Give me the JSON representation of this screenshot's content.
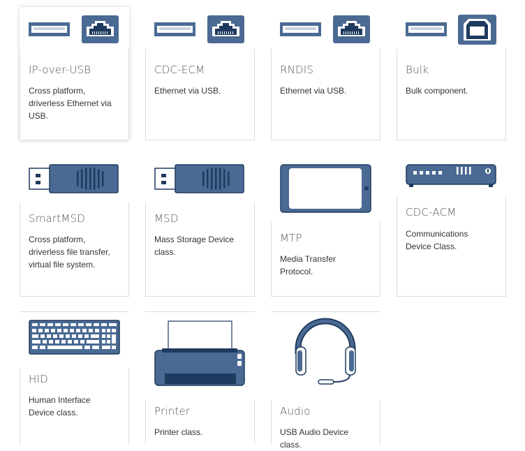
{
  "colors": {
    "icon_fill": "#4a6a93",
    "icon_dark": "#1f3a5f",
    "border": "#dcdcdc"
  },
  "cards": [
    {
      "title": "IP-over-USB",
      "description": "Cross platform, driverless Ethernet via USB.",
      "icon": "usb-ethernet-icon"
    },
    {
      "title": "CDC-ECM",
      "description": "Ethernet via USB.",
      "icon": "usb-ethernet-icon"
    },
    {
      "title": "RNDIS",
      "description": "Ethernet via USB.",
      "icon": "usb-ethernet-icon"
    },
    {
      "title": "Bulk",
      "description": "Bulk component.",
      "icon": "usb-b-connector-icon"
    },
    {
      "title": "SmartMSD",
      "description": "Cross platform, driverless file transfer, virtual file system.",
      "icon": "usb-stick-icon"
    },
    {
      "title": "MSD",
      "description": "Mass Storage Device class.",
      "icon": "usb-stick-icon"
    },
    {
      "title": "MTP",
      "description": "Media Transfer Protocol.",
      "icon": "tablet-icon"
    },
    {
      "title": "CDC-ACM",
      "description": "Communications Device Class.",
      "icon": "modem-icon"
    },
    {
      "title": "HID",
      "description": "Human Interface Device class.",
      "icon": "keyboard-icon"
    },
    {
      "title": "Printer",
      "description": "Printer class.",
      "icon": "printer-icon"
    },
    {
      "title": "Audio",
      "description": "USB Audio Device class.",
      "icon": "headset-icon"
    }
  ]
}
